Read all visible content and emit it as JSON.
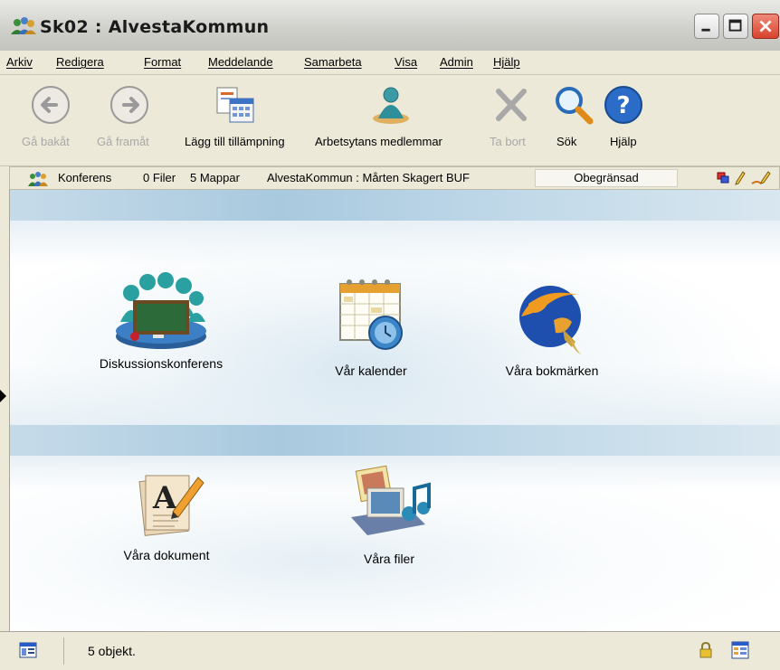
{
  "window": {
    "title": "Sk02 : AlvestaKommun"
  },
  "menu": [
    "Arkiv",
    "Redigera",
    "Format",
    "Meddelande",
    "Samarbeta",
    "Visa",
    "Admin",
    "Hjälp"
  ],
  "toolbar": {
    "back": "Gå bakåt",
    "forward": "Gå framåt",
    "add_app": "Lägg till tillämpning",
    "members": "Arbetsytans medlemmar",
    "delete": "Ta bort",
    "search": "Sök",
    "help": "Hjälp"
  },
  "infobar": {
    "type": "Konferens",
    "files": "0 Filer",
    "folders": "5 Mappar",
    "location": "AlvestaKommun : Mårten Skagert BUF",
    "access": "Obegränsad"
  },
  "apps": [
    {
      "label": "Diskussionskonferens",
      "icon": "discussion-conference-icon"
    },
    {
      "label": "Vår kalender",
      "icon": "calendar-icon"
    },
    {
      "label": "Våra bokmärken",
      "icon": "bookmarks-globe-icon"
    },
    {
      "label": "Våra dokument",
      "icon": "documents-icon"
    },
    {
      "label": "Våra filer",
      "icon": "files-icon"
    }
  ],
  "statusbar": {
    "count": "5 objekt."
  },
  "colors": {
    "band": "#a9c9df",
    "chrome": "#ece9d8",
    "close_button": "#d7432d"
  }
}
